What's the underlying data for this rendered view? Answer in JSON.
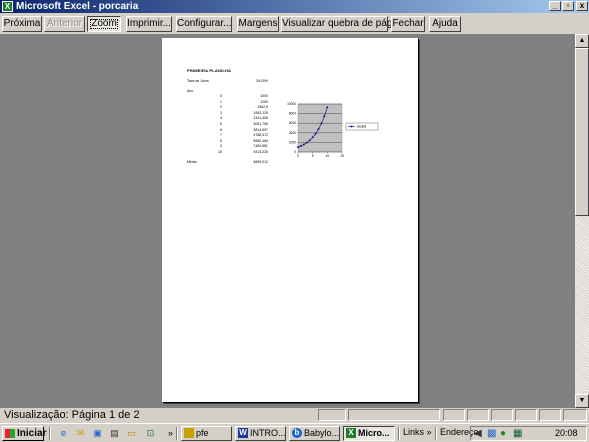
{
  "window": {
    "title": "Microsoft Excel - porcaria",
    "app_icon": "excel-icon",
    "minimize": "_",
    "maximize": "▫",
    "close": "x"
  },
  "toolbar": {
    "next": "Próxima",
    "previous": "Anterior",
    "zoom": "Zoom",
    "print": "Imprimir...",
    "setup": "Configurar...",
    "margins": "Margens",
    "page_break_preview": "Visualizar quebra de página",
    "close": "Fechar",
    "help": "Ajuda"
  },
  "sheet": {
    "title": "PRIMEIRA PLANILHA",
    "rate_label": "Taxa de Juros",
    "rate_value": "25,00%",
    "year_label": "Ano",
    "rows": [
      {
        "year": "0",
        "value": "1000"
      },
      {
        "year": "1",
        "value": "1250"
      },
      {
        "year": "2",
        "value": "1562,5"
      },
      {
        "year": "3",
        "value": "1953,125"
      },
      {
        "year": "4",
        "value": "2441,406"
      },
      {
        "year": "5",
        "value": "3051,758"
      },
      {
        "year": "6",
        "value": "3814,697"
      },
      {
        "year": "7",
        "value": "4768,372"
      },
      {
        "year": "8",
        "value": "5960,464"
      },
      {
        "year": "9",
        "value": "7450,581"
      },
      {
        "year": "10",
        "value": "9313,226"
      }
    ],
    "total_label": "Média",
    "total_value": "3690,012"
  },
  "chart_data": {
    "type": "line",
    "x": [
      0,
      1,
      2,
      3,
      4,
      5,
      6,
      7,
      8,
      9,
      10
    ],
    "series": [
      {
        "name": "Seqüê",
        "values": [
          1000,
          1250,
          1562.5,
          1953.125,
          2441.406,
          3051.758,
          3814.697,
          4768.372,
          5960.464,
          7450.581,
          9313.226
        ]
      }
    ],
    "xlim": [
      0,
      15
    ],
    "ylim": [
      0,
      10000
    ],
    "x_ticks": [
      "0",
      "5",
      "10",
      "15"
    ],
    "y_ticks": [
      "0",
      "2000",
      "4000",
      "6000",
      "8000",
      "10000"
    ],
    "grid": true,
    "legend": "right",
    "colors": {
      "line": "#000080",
      "plot_bg": "#c0c0c0"
    }
  },
  "statusbar": {
    "text": "Visualização: Página 1 de 2"
  },
  "taskbar": {
    "start": "Iniciar",
    "quicklaunch": [
      "ie-icon",
      "outlook-icon",
      "desktop-icon",
      "media-icon",
      "folder-icon"
    ],
    "chevron": "»",
    "tasks": [
      {
        "label": "pfe",
        "icon": "folder-icon",
        "active": false
      },
      {
        "label": "INTRO...",
        "icon": "word-icon",
        "active": false
      },
      {
        "label": "Babylo...",
        "icon": "babylon-icon",
        "active": false
      },
      {
        "label": "Micro...",
        "icon": "excel-icon",
        "active": true
      }
    ],
    "links": "Links",
    "links_chevron": "»",
    "address": "Endereço",
    "tray_icons": [
      "volume-icon",
      "network-icon",
      "messenger-icon",
      "misc-icon"
    ],
    "clock": "20:08"
  }
}
